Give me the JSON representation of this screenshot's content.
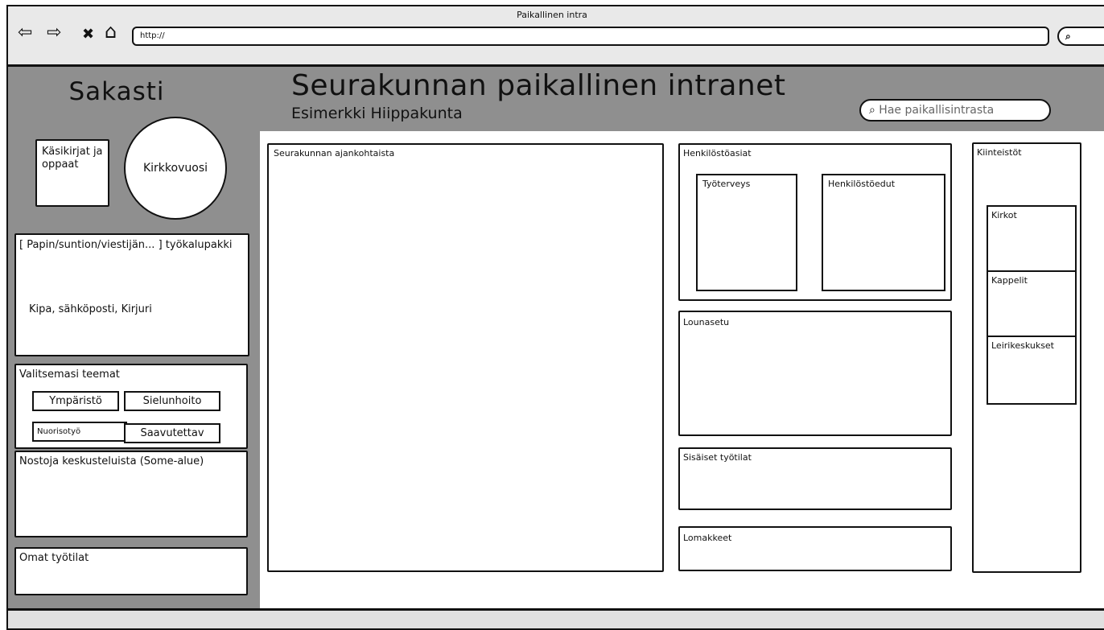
{
  "window": {
    "title": "Paikallinen intra",
    "url": "http://"
  },
  "nav": {
    "back": "⇦",
    "forward": "⇨",
    "stop": "✖",
    "home": "⌂",
    "search_glyph": "🔍︎"
  },
  "sidebar": {
    "title": "Sakasti",
    "manuals": "Käsikirjat ja oppaat",
    "church_year": "Kirkkovuosi",
    "toolkit": {
      "title": "[ Papin/suntion/viestijän... ] työkalupakki",
      "items": "Kipa, sähköposti, Kirjuri"
    },
    "themes": {
      "title": "Valitsemasi teemat",
      "items": [
        "Ympäristö",
        "Sielunhoito",
        "Nuorisotyö",
        "Saavutettav"
      ]
    },
    "discussion": "Nostoja keskusteluista (Some-alue)",
    "own_spaces": "Omat työtilat"
  },
  "header": {
    "title": "Seurakunnan paikallinen intranet",
    "subtitle": "Esimerkki Hiippakunta",
    "search_placeholder": "Hae paikallisintrasta"
  },
  "main": {
    "news": "Seurakunnan ajankohtaista",
    "hr": {
      "title": "Henkilöstöasiat",
      "items": [
        "Työterveys",
        "Henkilöstöedut"
      ]
    },
    "lunch": "Lounasetu",
    "workspaces": "Sisäiset työtilat",
    "forms": "Lomakkeet",
    "property": {
      "title": "Kiinteistöt",
      "items": [
        "Kirkot",
        "Kappelit",
        "Leirikeskukset"
      ]
    }
  }
}
